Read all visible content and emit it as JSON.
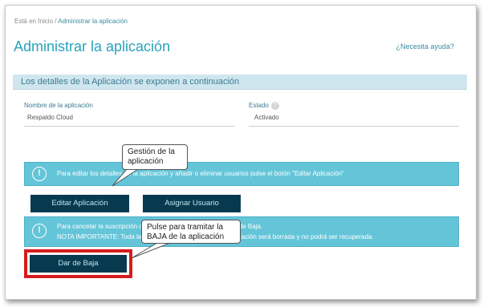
{
  "breadcrumb": {
    "prefix": "Está en Inicio / ",
    "current": "Administrar la aplicación"
  },
  "page": {
    "title": "Administrar la aplicación",
    "help_link": "¿Necesita ayuda?"
  },
  "details": {
    "section_title": "Los detalles de la Aplicación se exponen a continuación",
    "fields": {
      "name_label": "Nombre de la aplicación",
      "name_value": "Respaldo Cloud",
      "status_label": "Estado",
      "status_help_icon": "?",
      "status_value": "Activado"
    }
  },
  "edit_info": {
    "icon": "!",
    "text": "Para editar los detalles de la aplicación y añadir o eliminar usuarios pulse el botón \"Editar Aplicación\""
  },
  "buttons": {
    "edit_app": "Editar Aplicación",
    "assign_user": "Asignar Usuario",
    "unsubscribe": "Dar de Baja"
  },
  "cancel_info": {
    "icon": "!",
    "line1": "Para cancelar la suscripción de la aplicación pulse el botón Dar de Baja.",
    "line2": "NOTA IMPORTANTE: Toda la información asociada a dicha aplicación será borrada y no podrá ser recuperada."
  },
  "callouts": {
    "edit_callout": "Gestión de la aplicación",
    "unsubscribe_callout": "Pulse para tramitar la BAJA de la aplicación"
  },
  "colors": {
    "accent": "#29a3bb",
    "info_box": "#64c5d9",
    "button_dark": "#073a4f",
    "highlight_red": "#d61c1c"
  }
}
